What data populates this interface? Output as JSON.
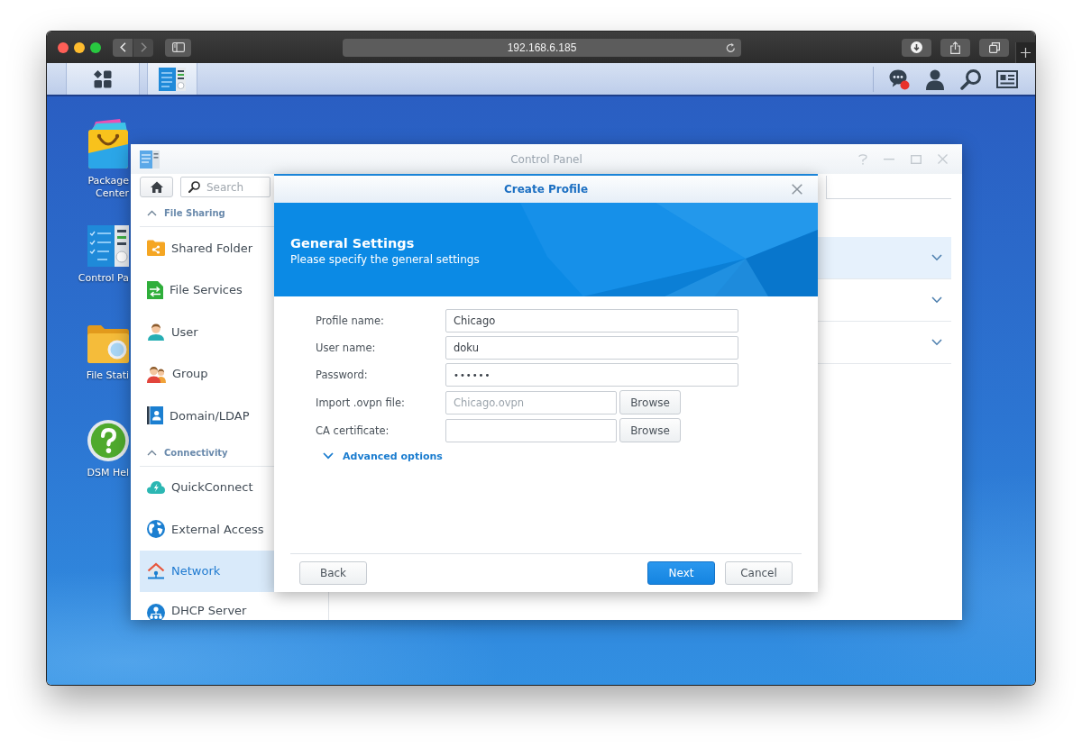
{
  "browser": {
    "nav_buttons": [
      {
        "kind": "back",
        "disabled": false
      },
      {
        "kind": "forward",
        "disabled": true
      }
    ],
    "url": "192.168.6.185"
  },
  "taskbar": {
    "apps": [
      {
        "selected": true
      }
    ]
  },
  "desktop_icons": [
    {
      "label": "Package Center"
    },
    {
      "label": "Control Pa"
    },
    {
      "label": "File Stati"
    },
    {
      "label": "DSM Hel"
    }
  ],
  "control_panel": {
    "title": "Control Panel",
    "search": {
      "placeholder": "Search"
    },
    "sidebar": [
      {
        "label": "File Sharing",
        "expanded": true,
        "items": [
          {
            "label": "Shared Folder",
            "selected": false
          },
          {
            "label": "File Services",
            "selected": false
          },
          {
            "label": "User",
            "selected": false
          },
          {
            "label": "Group",
            "selected": false
          },
          {
            "label": "Domain/LDAP",
            "selected": false
          }
        ]
      },
      {
        "label": "Connectivity",
        "expanded": true,
        "items": [
          {
            "label": "QuickConnect",
            "selected": false
          },
          {
            "label": "External Access",
            "selected": false
          },
          {
            "label": "Network",
            "selected": true
          },
          {
            "label": "DHCP Server",
            "selected": false
          }
        ]
      }
    ],
    "panel_rows": [
      {
        "selected": true,
        "expanded": false
      },
      {
        "selected": false,
        "expanded": false
      },
      {
        "selected": false,
        "expanded": false
      }
    ]
  },
  "dialog": {
    "title": "Create Profile",
    "heading": "General Settings",
    "subheading": "Please specify the general settings",
    "fields": [
      {
        "kind": "text",
        "label": "Profile name:",
        "value": "Chicago",
        "readonly": false
      },
      {
        "kind": "text",
        "label": "User name:",
        "value": "doku",
        "readonly": false
      },
      {
        "kind": "password",
        "label": "Password:",
        "value": "••••••",
        "readonly": false
      },
      {
        "kind": "file",
        "label": "Import .ovpn file:",
        "value": "Chicago.ovpn",
        "readonly": true,
        "button": "Browse"
      },
      {
        "kind": "file",
        "label": "CA certificate:",
        "button": "Browse"
      }
    ],
    "advanced": {
      "label": "Advanced options",
      "expanded": false
    },
    "left_buttons": [
      {
        "label": "Back",
        "primary": false
      }
    ],
    "right_buttons": [
      {
        "label": "Next",
        "primary": true
      },
      {
        "label": "Cancel",
        "primary": false
      }
    ]
  }
}
